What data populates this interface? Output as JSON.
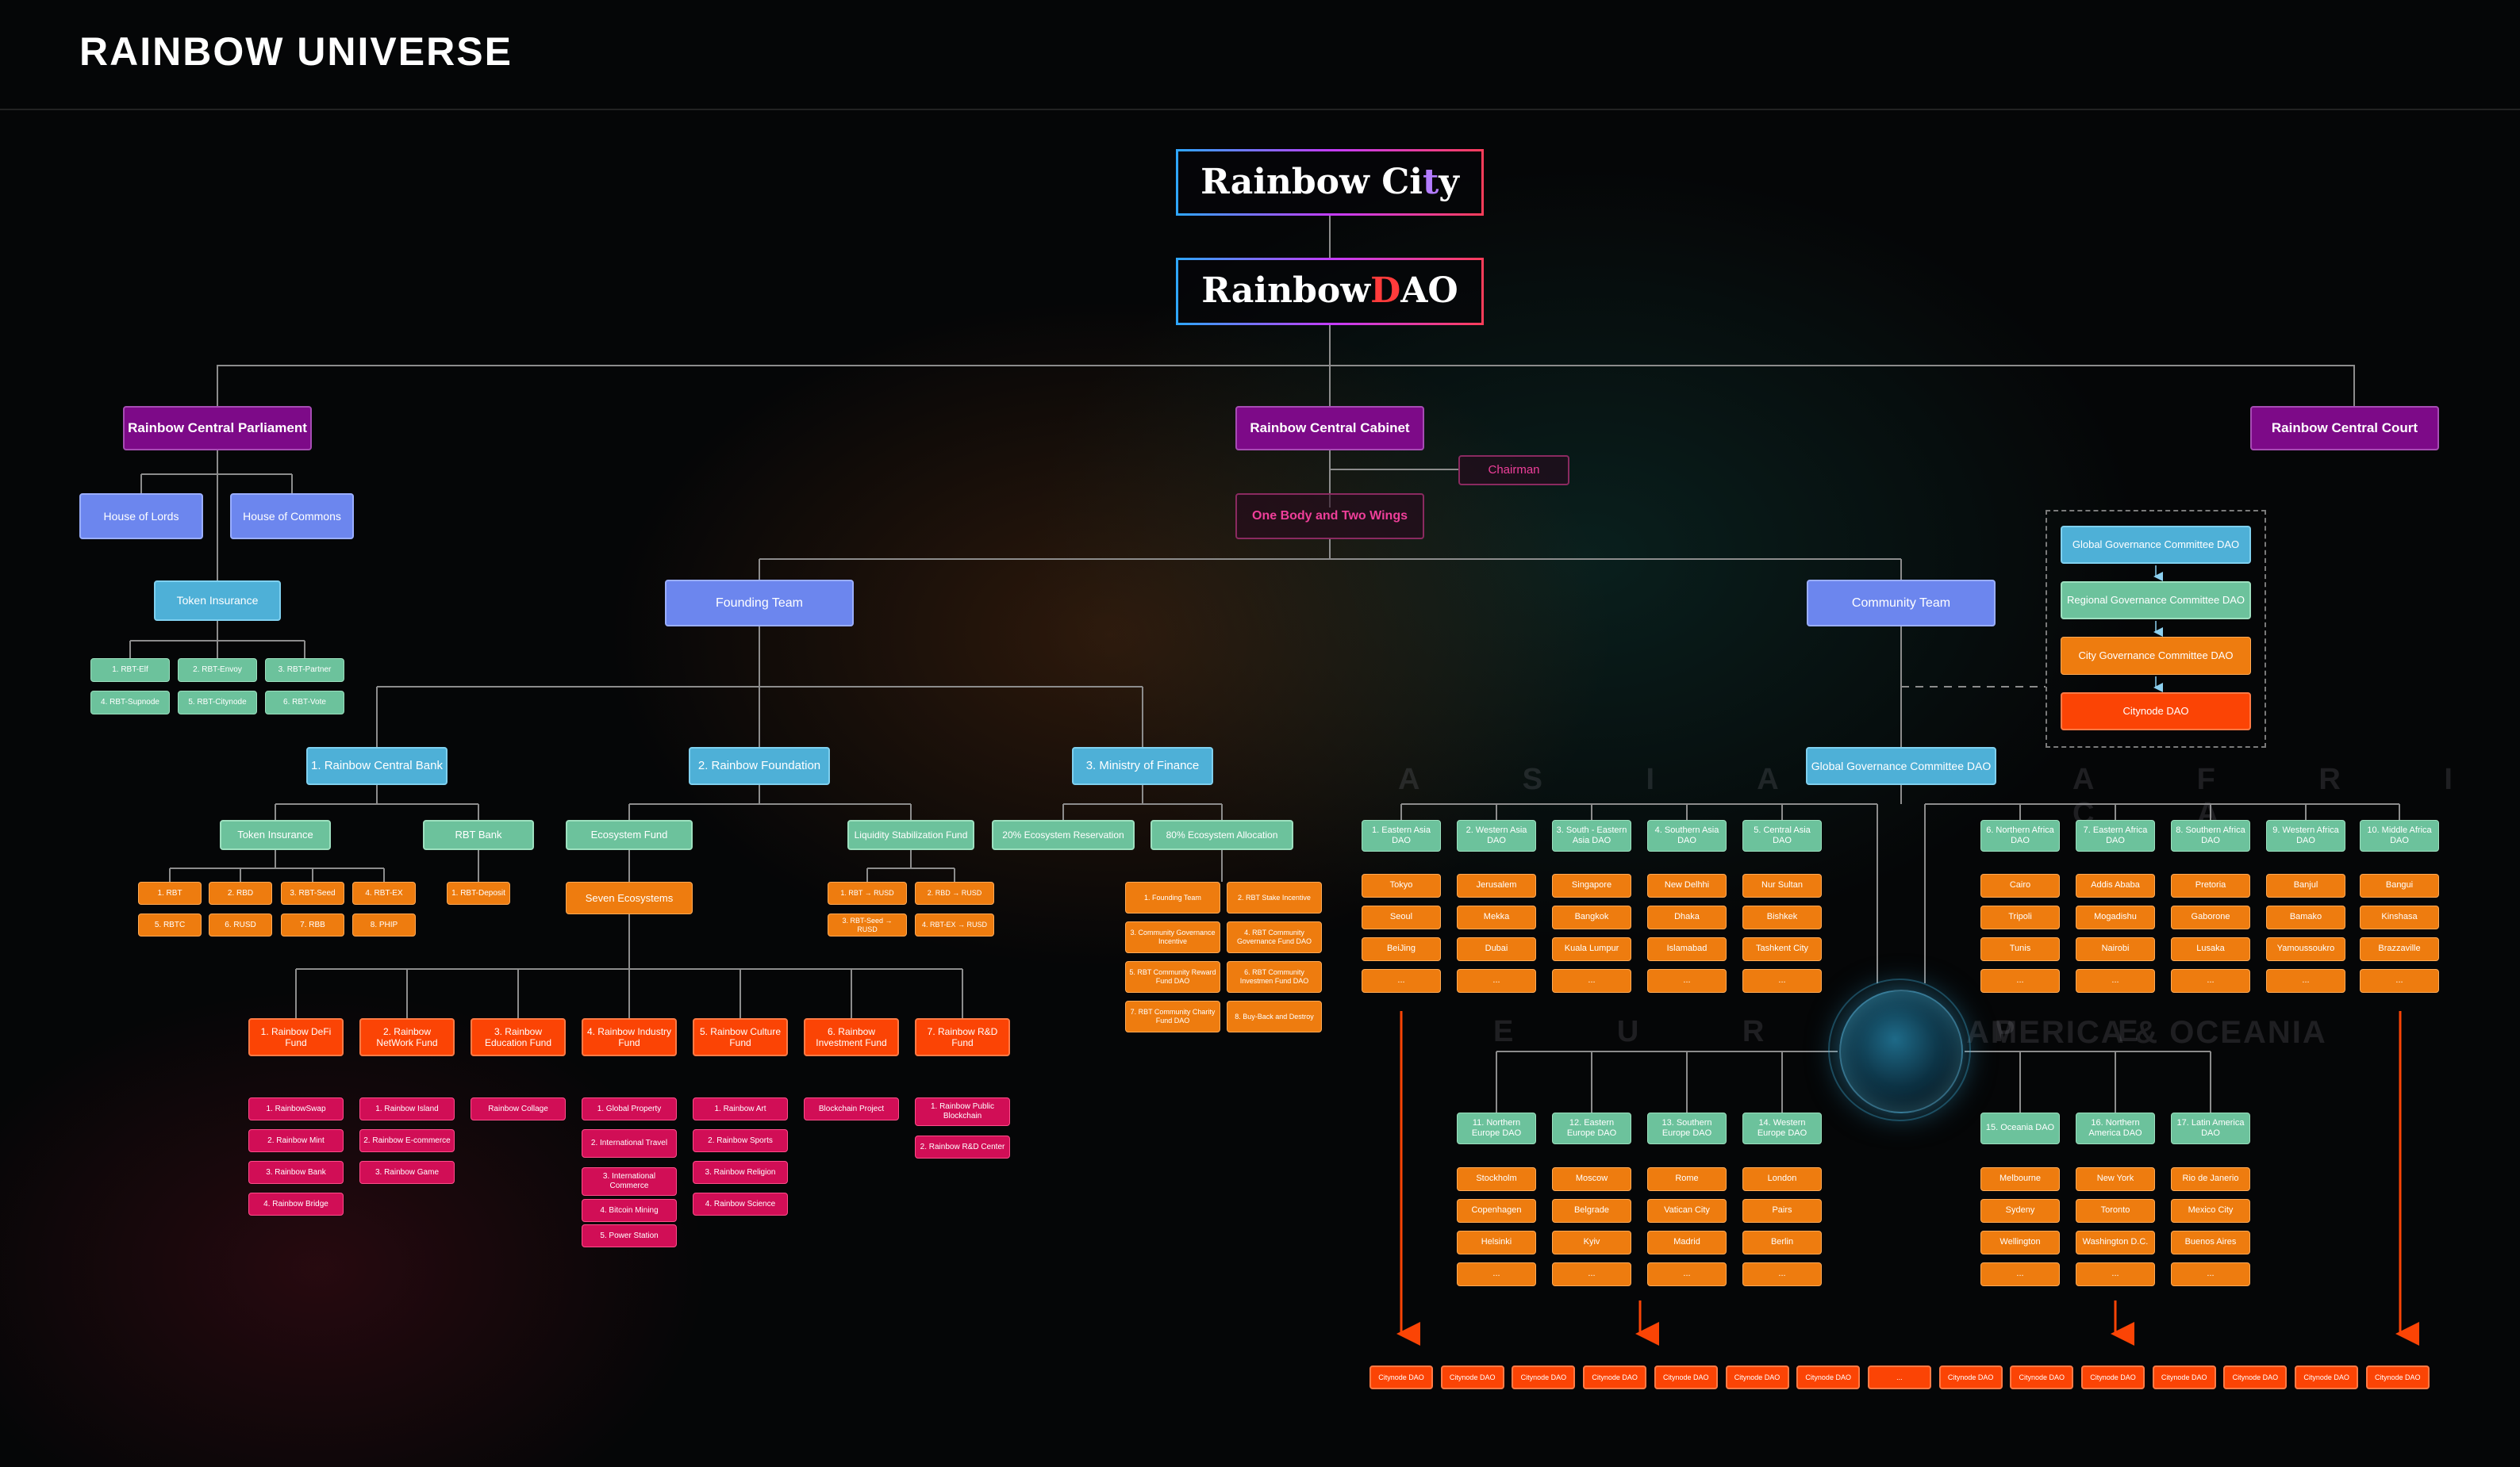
{
  "page": {
    "title": "RAINBOW  UNIVERSE"
  },
  "brand": {
    "city_a": "Rainbow Ci",
    "city_b": "t",
    "city_c": "y",
    "dao_a": "Rainbow ",
    "dao_b": "D",
    "dao_c": "AO"
  },
  "top": {
    "parliament": "Rainbow Central Parliament",
    "cabinet": "Rainbow Central Cabinet",
    "court": "Rainbow Central Court",
    "chairman": "Chairman",
    "one_body": "One Body and Two Wings"
  },
  "parliament": {
    "lords": "House of Lords",
    "commons": "House of Commons",
    "token_insurance": "Token Insurance",
    "tokens": [
      "1. RBT-Elf",
      "2. RBT-Envoy",
      "3. RBT-Partner",
      "4. RBT-Supnode",
      "5. RBT-Citynode",
      "6. RBT-Vote"
    ]
  },
  "teams": {
    "founding": "Founding Team",
    "community": "Community Team"
  },
  "governance": {
    "global": "Global Governance Committee DAO",
    "regional": "Regional Governance Committee DAO",
    "city": "City Governance Committee DAO",
    "citynode": "Citynode DAO"
  },
  "founding": {
    "bank": "1. Rainbow Central Bank",
    "foundation": "2. Rainbow Foundation",
    "finance": "3. Ministry of Finance"
  },
  "bank": {
    "token_insurance": "Token Insurance",
    "rbt_bank": "RBT Bank",
    "tokens": [
      "1. RBT",
      "2. RBD",
      "3. RBT-Seed",
      "4. RBT-EX",
      "5. RBTC",
      "6. RUSD",
      "7. RBB",
      "8. PHIP"
    ],
    "deposit": "1. RBT-Deposit"
  },
  "foundation": {
    "ecosystem_fund": "Ecosystem Fund",
    "seven": "Seven Ecosystems",
    "liquidity": "Liquidity Stabilization Fund",
    "pairs": [
      "1. RBT → RUSD",
      "2. RBD → RUSD",
      "3. RBT-Seed → RUSD",
      "4. RBT-EX → RUSD"
    ]
  },
  "finance": {
    "reservation": "20% Ecosystem Reservation",
    "allocation": "80% Ecosystem Allocation",
    "alloc_items": [
      "1. Founding Team",
      "2. RBT Stake Incentive",
      "3. Community Governance Incentive",
      "4. RBT Community Governance Fund DAO",
      "5. RBT Community Reward Fund DAO",
      "6. RBT Community Investmen Fund DAO",
      "7. RBT Community Charity Fund DAO",
      "8. Buy-Back and Destroy"
    ]
  },
  "funds": [
    {
      "name": "1. Rainbow DeFi Fund",
      "items": [
        "1. RainbowSwap",
        "2. Rainbow Mint",
        "3. Rainbow Bank",
        "4. Rainbow Bridge"
      ]
    },
    {
      "name": "2. Rainbow NetWork Fund",
      "items": [
        "1. Rainbow Island",
        "2. Rainbow E-commerce",
        "3. Rainbow Game"
      ]
    },
    {
      "name": "3. Rainbow Education Fund",
      "items": [
        "Rainbow Collage"
      ]
    },
    {
      "name": "4. Rainbow Industry Fund",
      "items": [
        "1. Global Property",
        "2. International Travel",
        "3. International Commerce",
        "4. Bitcoin Mining",
        "5. Power Station"
      ]
    },
    {
      "name": "5. Rainbow Culture Fund",
      "items": [
        "1. Rainbow Art",
        "2. Rainbow Sports",
        "3. Rainbow Religion",
        "4. Rainbow Science"
      ]
    },
    {
      "name": "6. Rainbow Investment Fund",
      "items": [
        "Blockchain Project"
      ]
    },
    {
      "name": "7. Rainbow R&D Fund",
      "items": [
        "1. Rainbow Public Blockchain",
        "2. Rainbow R&D Center"
      ]
    }
  ],
  "community": {
    "global_dao": "Global Governance Committee DAO"
  },
  "continents": {
    "asia": "A S I A",
    "africa": "A F R I C A",
    "europe": "E U R O P E",
    "america": "AMERICA & OCEANIA"
  },
  "asia": [
    {
      "name": "1. Eastern Asia DAO",
      "cities": [
        "Tokyo",
        "Seoul",
        "BeiJing",
        "..."
      ]
    },
    {
      "name": "2. Western Asia DAO",
      "cities": [
        "Jerusalem",
        "Mekka",
        "Dubai",
        "..."
      ]
    },
    {
      "name": "3. South - Eastern Asia DAO",
      "cities": [
        "Singapore",
        "Bangkok",
        "Kuala Lumpur",
        "..."
      ]
    },
    {
      "name": "4. Southern Asia DAO",
      "cities": [
        "New Delhhi",
        "Dhaka",
        "Islamabad",
        "..."
      ]
    },
    {
      "name": "5. Central Asia DAO",
      "cities": [
        "Nur Sultan",
        "Bishkek",
        "Tashkent City",
        "..."
      ]
    }
  ],
  "africa": [
    {
      "name": "6. Northern Africa DAO",
      "cities": [
        "Cairo",
        "Tripoli",
        "Tunis",
        "..."
      ]
    },
    {
      "name": "7. Eastern Africa DAO",
      "cities": [
        "Addis Ababa",
        "Mogadishu",
        "Nairobi",
        "..."
      ]
    },
    {
      "name": "8. Southern Africa DAO",
      "cities": [
        "Pretoria",
        "Gaborone",
        "Lusaka",
        "..."
      ]
    },
    {
      "name": "9. Western Africa DAO",
      "cities": [
        "Banjul",
        "Bamako",
        "Yamoussoukro",
        "..."
      ]
    },
    {
      "name": "10. Middle Africa DAO",
      "cities": [
        "Bangui",
        "Kinshasa",
        "Brazzaville",
        "..."
      ]
    }
  ],
  "europe": [
    {
      "name": "11. Northern Europe DAO",
      "cities": [
        "Stockholm",
        "Copenhagen",
        "Helsinki",
        "..."
      ]
    },
    {
      "name": "12. Eastern Europe DAO",
      "cities": [
        "Moscow",
        "Belgrade",
        "Kyiv",
        "..."
      ]
    },
    {
      "name": "13. Southern Europe DAO",
      "cities": [
        "Rome",
        "Vatican City",
        "Madrid",
        "..."
      ]
    },
    {
      "name": "14. Western Europe DAO",
      "cities": [
        "London",
        "Pairs",
        "Berlin",
        "..."
      ]
    }
  ],
  "america": [
    {
      "name": "15. Oceania DAO",
      "cities": [
        "Melbourne",
        "Sydeny",
        "Wellington",
        "..."
      ]
    },
    {
      "name": "16. Northern America DAO",
      "cities": [
        "New York",
        "Toronto",
        "Washington D.C.",
        "..."
      ]
    },
    {
      "name": "17. Latin America DAO",
      "cities": [
        "Rio de Janerio",
        "Mexico City",
        "Buenos Aires",
        "..."
      ]
    }
  ],
  "citynodes": [
    "Citynode DAO",
    "Citynode DAO",
    "Citynode DAO",
    "Citynode DAO",
    "Citynode DAO",
    "Citynode DAO",
    "Citynode DAO",
    "...",
    "Citynode DAO",
    "Citynode DAO",
    "Citynode DAO",
    "Citynode DAO",
    "Citynode DAO",
    "Citynode DAO",
    "Citynode DAO"
  ],
  "colors": {
    "line": "#8c8c8c",
    "arrow": "#fb4405",
    "purple": "#7d0a88",
    "blue": "#6c86ee",
    "cyan": "#4eb0d7",
    "green": "#6cc29c",
    "orange": "#ee7c0f",
    "red": "#fb4405",
    "pink": "#d10e56"
  }
}
